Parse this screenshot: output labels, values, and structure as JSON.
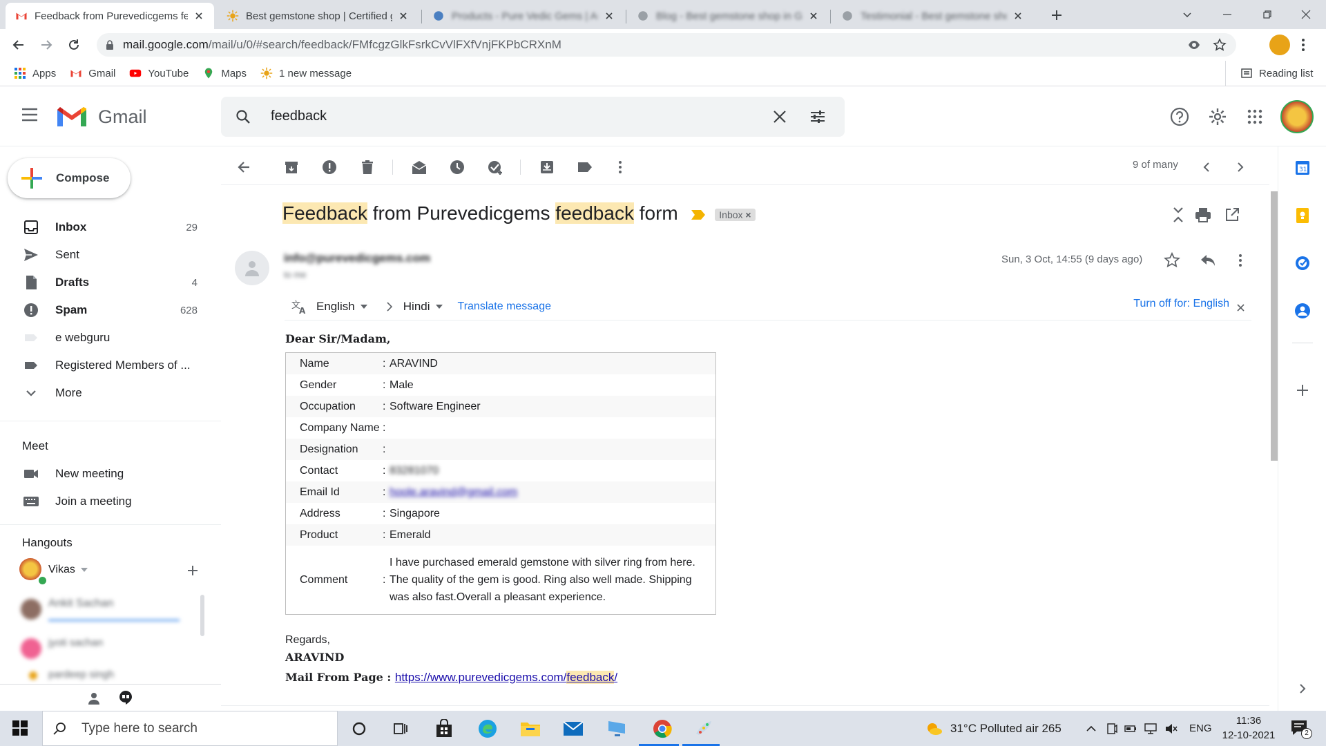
{
  "browser": {
    "tabs": [
      {
        "title": "Feedback from Purevedicgems fe",
        "active": true
      },
      {
        "title": "Best gemstone shop | Certified g",
        "active": false
      },
      {
        "title": "Products - Pure Vedic Gems | Au",
        "active": false
      },
      {
        "title": "Blog - Best gemstone shop in Gr",
        "active": false
      },
      {
        "title": "Testimonial - Best gemstone sho",
        "active": false
      }
    ],
    "url_host": "mail.google.com",
    "url_path": "/mail/u/0/#search/feedback/FMfcgzGlkFsrkCvVlFXfVnjFKPbCRXnM",
    "bookmarks": [
      "Apps",
      "Gmail",
      "YouTube",
      "Maps",
      "1 new message"
    ],
    "reading_list": "Reading list"
  },
  "gmail": {
    "logo_text": "Gmail",
    "search_query": "feedback",
    "compose_label": "Compose",
    "nav": [
      {
        "label": "Inbox",
        "count": "29",
        "bold": true
      },
      {
        "label": "Sent",
        "count": "",
        "bold": false
      },
      {
        "label": "Drafts",
        "count": "4",
        "bold": true
      },
      {
        "label": "Spam",
        "count": "628",
        "bold": true
      },
      {
        "label": "e webguru",
        "count": "",
        "bold": false
      },
      {
        "label": "Registered Members of ...",
        "count": "",
        "bold": false
      },
      {
        "label": "More",
        "count": "",
        "bold": false
      }
    ],
    "meet": {
      "title": "Meet",
      "new_meeting": "New meeting",
      "join_meeting": "Join a meeting"
    },
    "hangouts": {
      "title": "Hangouts",
      "user": "Vikas",
      "contacts": [
        "Ankit Sachan",
        "jyoti sachan",
        "pardeep singh"
      ]
    },
    "pagination": "9 of many"
  },
  "email": {
    "subject_parts": [
      "Feedback",
      " from Purevedicgems ",
      "feedback",
      " form"
    ],
    "label": "Inbox",
    "sender": "info@purevedicgems.com",
    "to_me": "to me",
    "date": "Sun, 3 Oct, 14:55 (9 days ago)",
    "translate": {
      "from": "English",
      "to": "Hindi",
      "action": "Translate message",
      "turn_off": "Turn off for: English"
    },
    "greeting": "Dear Sir/Madam,",
    "form": [
      {
        "key": "Name",
        "value": "ARAVIND"
      },
      {
        "key": "Gender",
        "value": "Male"
      },
      {
        "key": "Occupation",
        "value": "Software Engineer"
      },
      {
        "key": "Company Name",
        "value": ""
      },
      {
        "key": "Designation",
        "value": ""
      },
      {
        "key": "Contact",
        "value": "83281070"
      },
      {
        "key": "Email Id",
        "value": "hoole.aravind@gmail.com"
      },
      {
        "key": "Address",
        "value": "Singapore"
      },
      {
        "key": "Product",
        "value": "Emerald"
      }
    ],
    "comment_key": "Comment",
    "comment_lines": [
      "I have purchased emerald gemstone with silver ring from here.",
      "The quality of the gem is good. Ring also well made. Shipping",
      "was also fast.Overall a pleasant experience."
    ],
    "regards": "Regards,",
    "signature": "ARAVIND",
    "mail_from_label": "Mail From Page : ",
    "mail_from_link_a": "https://www.purevedicgems.com/",
    "mail_from_link_b": "feedback",
    "mail_from_link_c": "/"
  },
  "taskbar": {
    "search_placeholder": "Type here to search",
    "weather": "31°C  Polluted air 265",
    "lang": "ENG",
    "time": "11:36",
    "date": "12-10-2021",
    "notif_count": "2"
  }
}
